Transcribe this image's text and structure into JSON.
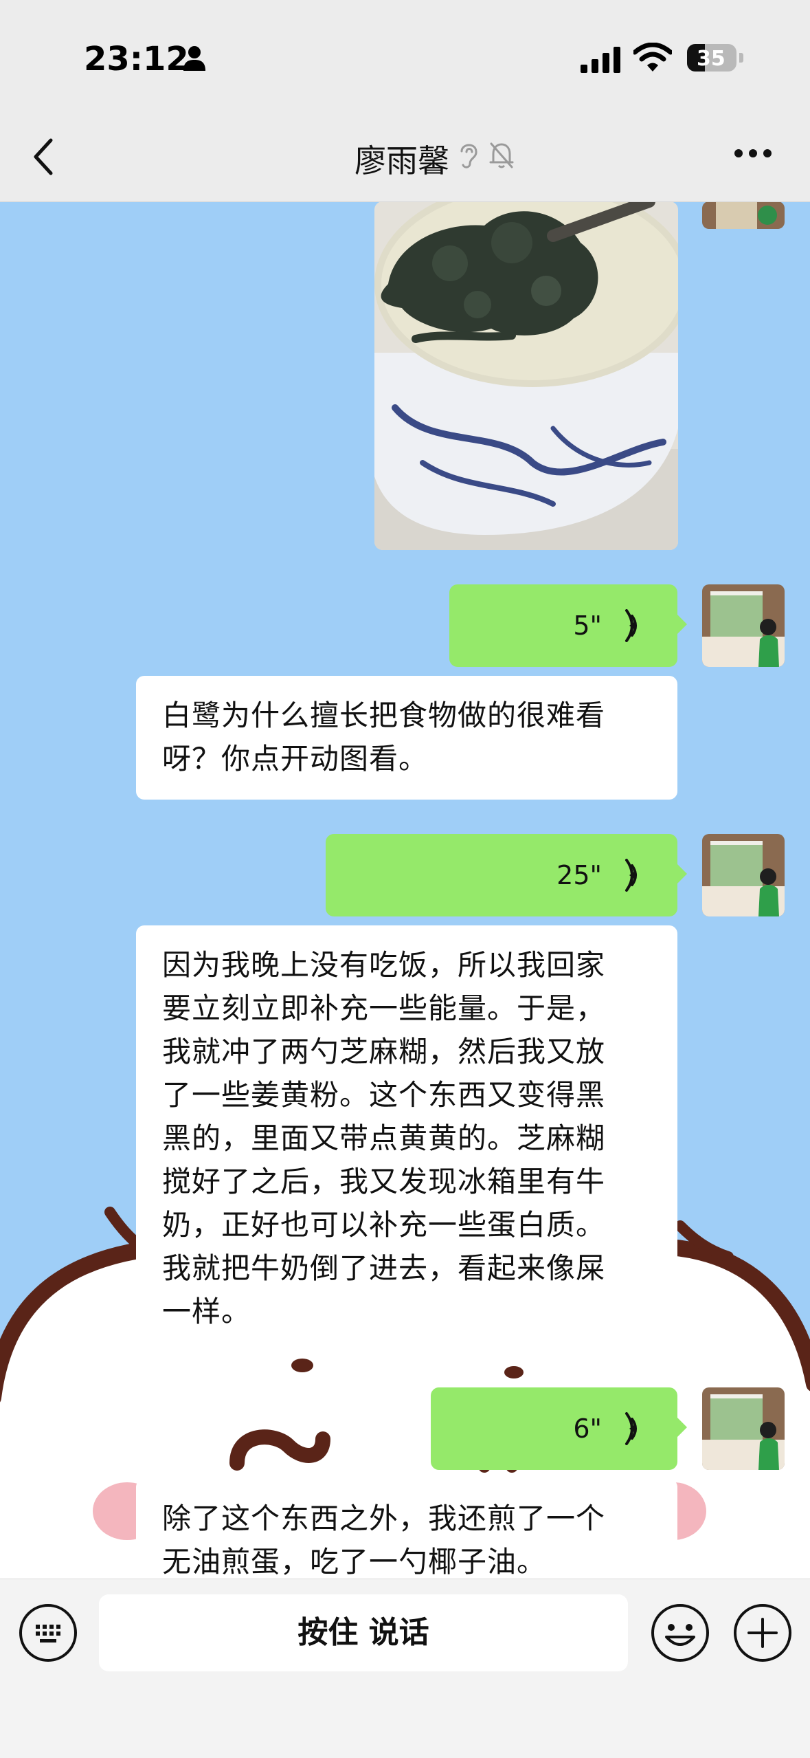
{
  "status_bar": {
    "time": "23:12",
    "battery": "35"
  },
  "header": {
    "title": "廖雨馨"
  },
  "messages": {
    "voice_1": "5\"",
    "text_1": "白鹭为什么擅长把食物做的很难看\n呀？你点开动图看。",
    "voice_2": "25\"",
    "text_2": "因为我晚上没有吃饭，所以我回家\n要立刻立即补充一些能量。于是，\n我就冲了两勺芝麻糊，然后我又放\n了一些姜黄粉。这个东西又变得黑\n黑的，里面又带点黄黄的。芝麻糊\n搅好了之后，我又发现冰箱里有牛\n奶，正好也可以补充一些蛋白质。\n我就把牛奶倒了进去，看起来像屎\n一样。",
    "voice_3": "6\"",
    "text_3": "除了这个东西之外，我还煎了一个\n无油煎蛋，吃了一勺椰子油。"
  },
  "input_bar": {
    "hold_to_talk": "按住 说话"
  },
  "colors": {
    "chat_bg": "#9fcef7",
    "voice_bubble": "#95e96a",
    "bar_bg": "#ececec"
  },
  "icons": [
    "person-icon",
    "signal-icon",
    "wifi-icon",
    "back-icon",
    "ear-icon",
    "mute-icon",
    "more-icon",
    "voice-wave-icon",
    "keyboard-icon",
    "emoji-icon",
    "plus-icon"
  ]
}
